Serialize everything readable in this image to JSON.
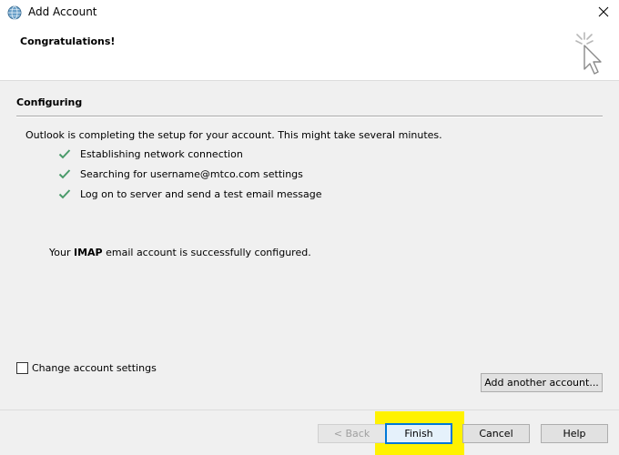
{
  "window": {
    "title": "Add Account",
    "close_icon": "close-icon",
    "app_icon": "outlook-globe-icon"
  },
  "header": {
    "title": "Congratulations!",
    "art_icon": "click-cursor-icon"
  },
  "section": {
    "title": "Configuring",
    "status": "Outlook is completing the setup for your account. This might take several minutes.",
    "tasks": [
      {
        "label": "Establishing network connection",
        "state": "done"
      },
      {
        "label": "Searching for username@mtco.com settings",
        "state": "done"
      },
      {
        "label": "Log on to server and send a test email message",
        "state": "done"
      }
    ],
    "result_prefix": "Your ",
    "result_bold": "IMAP",
    "result_suffix": " email account is successfully configured."
  },
  "options": {
    "change_settings_label": "Change account settings",
    "change_settings_checked": false,
    "add_another_label": "Add another account..."
  },
  "footer": {
    "back_label": "< Back",
    "finish_label": "Finish",
    "cancel_label": "Cancel",
    "help_label": "Help"
  },
  "colors": {
    "check_green": "#4a9a6a",
    "highlight": "#fff200",
    "focus_blue": "#0078d7"
  }
}
